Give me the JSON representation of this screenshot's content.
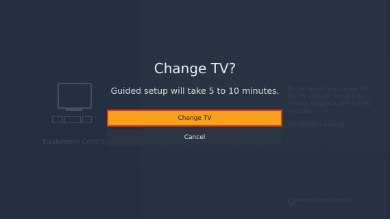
{
  "background": {
    "label": "Equipment Control",
    "info_text": "To change the equipment that Fire TV controls, select it in Guided Setup will take 5 to 10 minutes.",
    "info_text_2": "Connected Samsung",
    "remove_label": "Remove this device"
  },
  "dialog": {
    "title": "Change TV?",
    "message": "Guided setup will take 5 to 10 minutes.",
    "confirm_label": "Change TV",
    "cancel_label": "Cancel"
  },
  "colors": {
    "primary": "#f9a11b",
    "focus_border": "#e0341a",
    "background": "#232f3e"
  }
}
